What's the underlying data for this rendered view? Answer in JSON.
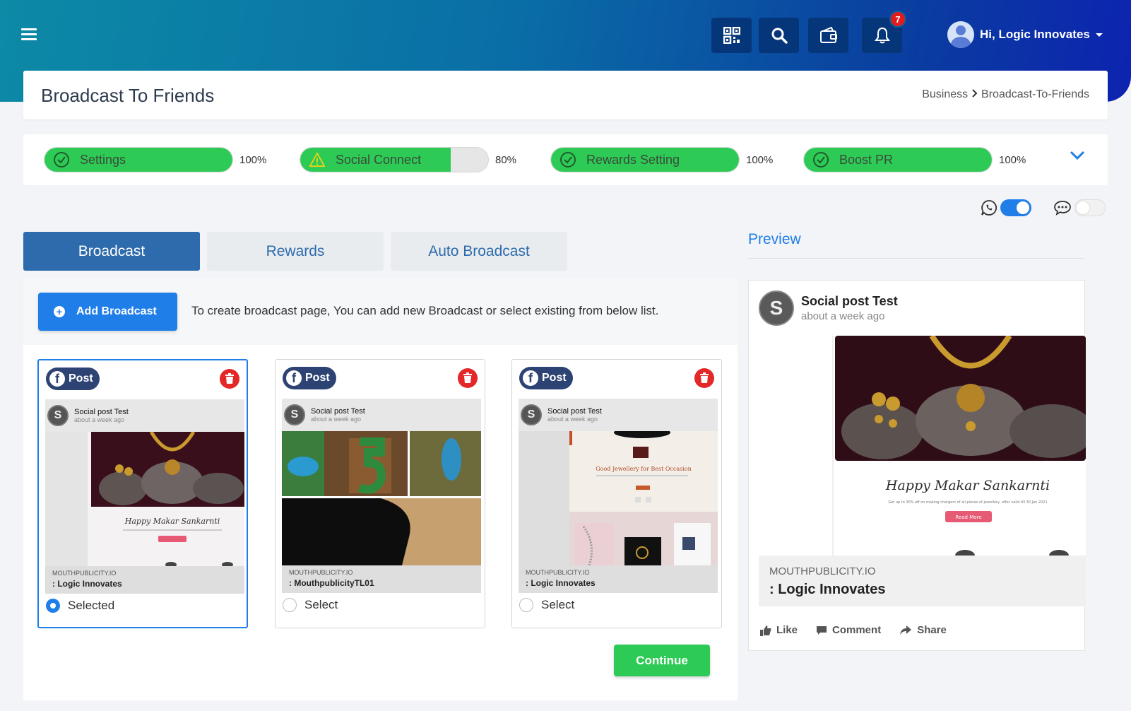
{
  "header": {
    "user_greeting": "Hi, Logic Innovates",
    "notification_count": "7"
  },
  "page": {
    "title": "Broadcast To Friends",
    "breadcrumb": [
      "Business",
      "Broadcast-To-Friends"
    ]
  },
  "progress": [
    {
      "label": "Settings",
      "percent": 100,
      "percent_text": "100%",
      "status": "complete"
    },
    {
      "label": "Social Connect",
      "percent": 80,
      "percent_text": "80%",
      "status": "warning"
    },
    {
      "label": "Rewards Setting",
      "percent": 100,
      "percent_text": "100%",
      "status": "complete"
    },
    {
      "label": "Boost PR",
      "percent": 100,
      "percent_text": "100%",
      "status": "complete"
    }
  ],
  "toggles": {
    "whatsapp_enabled": true,
    "sms_enabled": false
  },
  "tabs": [
    "Broadcast",
    "Rewards",
    "Auto Broadcast"
  ],
  "active_tab": "Broadcast",
  "add_broadcast": {
    "button_label": "Add Broadcast",
    "hint": "To create broadcast page, You can add new Broadcast or select existing from below list."
  },
  "cards": [
    {
      "type_label": "Post",
      "author": "Social post Test",
      "time": "about a week ago",
      "site": "MOUTHPUBLICITY.IO",
      "business": ": Logic Innovates",
      "select_label": "Selected",
      "selected": true
    },
    {
      "type_label": "Post",
      "author": "Social post Test",
      "time": "about a week ago",
      "site": "MOUTHPUBLICITY.IO",
      "business": ": MouthpublicityTL01",
      "select_label": "Select",
      "selected": false
    },
    {
      "type_label": "Post",
      "author": "Social post Test",
      "time": "about a week ago",
      "site": "MOUTHPUBLICITY.IO",
      "business": ": Logic Innovates",
      "select_label": "Select",
      "selected": false
    }
  ],
  "card_images": {
    "greeting": "Happy Makar Sankarnti",
    "offer": "Get up to 30% off on making chargers of all pieces of jewellery, offer valid till 30 Jan 2021",
    "cta": "Read More",
    "jewel_heading": "Good Jewellery for Best Occasion"
  },
  "continue_label": "Continue",
  "preview": {
    "heading": "Preview",
    "avatar_letter": "S",
    "author": "Social post Test",
    "time": "about a week ago",
    "site": "MOUTHPUBLICITY.IO",
    "business": ": Logic Innovates",
    "actions": [
      "Like",
      "Comment",
      "Share"
    ]
  },
  "colors": {
    "primary": "#1f7ee8",
    "tab_active": "#2d6bac",
    "success": "#2dcb55",
    "danger": "#e42727",
    "facebook": "#2d4373"
  }
}
